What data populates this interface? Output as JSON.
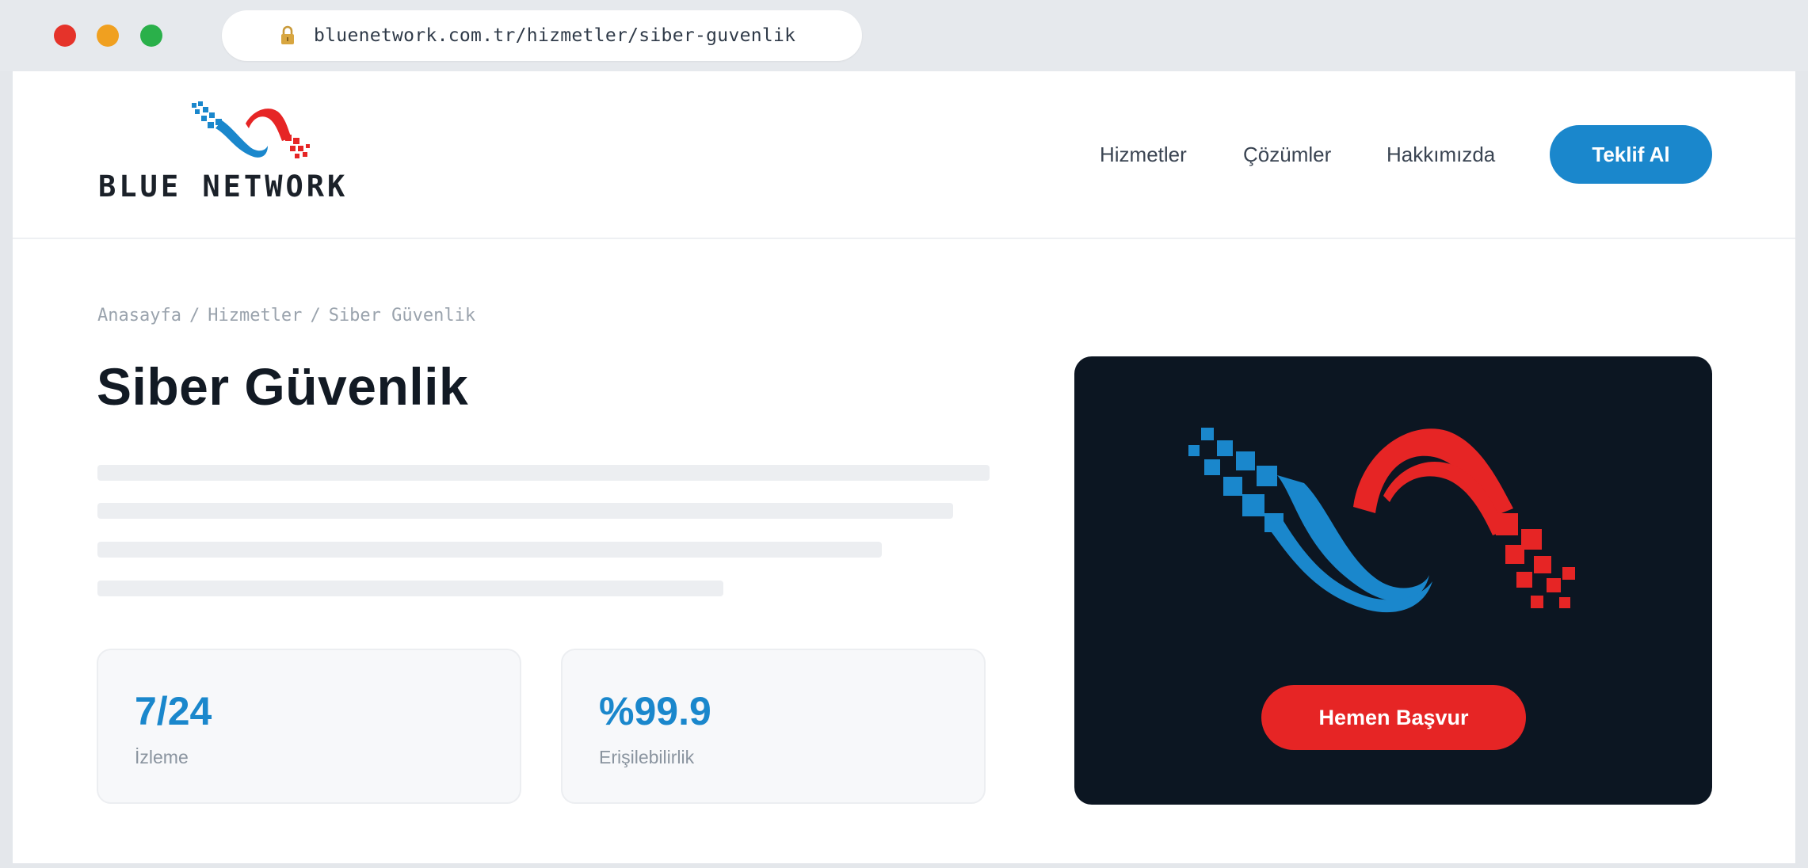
{
  "browser": {
    "url": "bluenetwork.com.tr/hizmetler/siber-guvenlik",
    "controls": {
      "close_color": "#e5332a",
      "minimize_color": "#f0a020",
      "maximize_color": "#2ab04a"
    }
  },
  "header": {
    "brand": "BLUE NETWORK",
    "nav": [
      "Hizmetler",
      "Çözümler",
      "Hakkımızda"
    ],
    "cta_label": "Teklif Al"
  },
  "breadcrumb": [
    "Anasayfa",
    "Hizmetler",
    "Siber Güvenlik"
  ],
  "page": {
    "title": "Siber Güvenlik"
  },
  "stats": [
    {
      "value": "7/24",
      "label": "İzleme"
    },
    {
      "value": "%99.9",
      "label": "Erişilebilirlik"
    }
  ],
  "hero": {
    "cta_label": "Hemen Başvur"
  },
  "colors": {
    "brand_blue": "#1a87cc",
    "brand_red": "#e62525",
    "hero_bg": "#0c1622"
  },
  "icons": [
    "lock-icon",
    "brand-logo-icon"
  ]
}
